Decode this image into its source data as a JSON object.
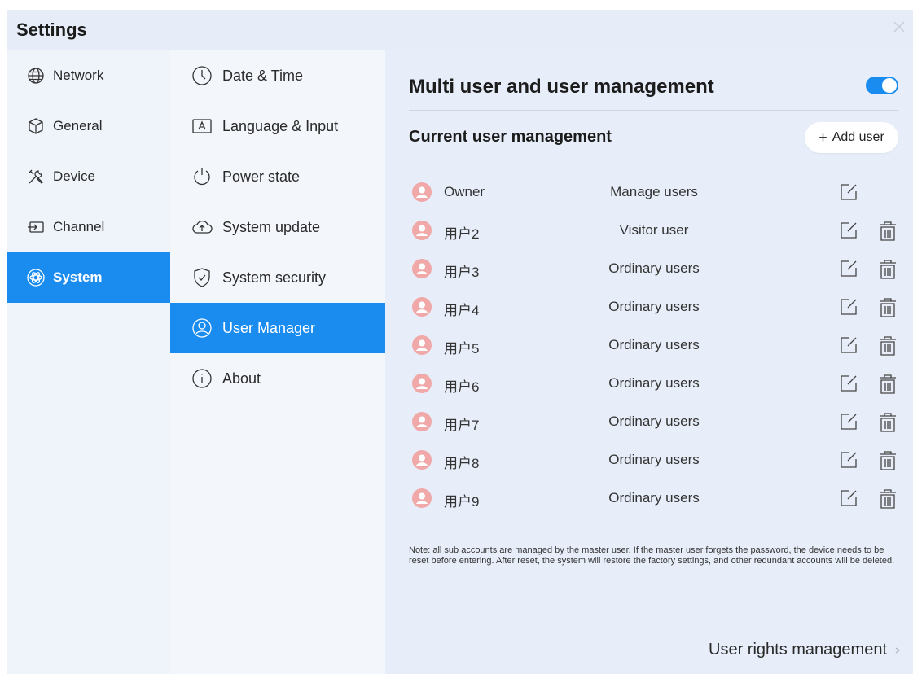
{
  "window": {
    "title": "Settings"
  },
  "nav1": {
    "items": [
      {
        "label": "Network",
        "icon": "globe-icon"
      },
      {
        "label": "General",
        "icon": "cube-icon"
      },
      {
        "label": "Device",
        "icon": "tools-icon"
      },
      {
        "label": "Channel",
        "icon": "input-icon"
      },
      {
        "label": "System",
        "icon": "atom-icon",
        "active": true
      }
    ]
  },
  "nav2": {
    "items": [
      {
        "label": "Date & Time",
        "icon": "clock-icon"
      },
      {
        "label": "Language & Input",
        "icon": "keyboard-a-icon"
      },
      {
        "label": "Power state",
        "icon": "power-icon"
      },
      {
        "label": "System update",
        "icon": "cloud-upload-icon"
      },
      {
        "label": "System security",
        "icon": "shield-icon"
      },
      {
        "label": "User Manager",
        "icon": "user-icon",
        "active": true
      },
      {
        "label": "About",
        "icon": "info-icon"
      }
    ]
  },
  "main": {
    "section_title": "Multi user and user management",
    "toggle_on": true,
    "subtitle": "Current user management",
    "add_user_label": "Add user",
    "users": [
      {
        "name": "Owner",
        "role": "Manage users",
        "deletable": false
      },
      {
        "name": "用户2",
        "role": "Visitor user",
        "deletable": true
      },
      {
        "name": "用户3",
        "role": "Ordinary users",
        "deletable": true
      },
      {
        "name": "用户4",
        "role": "Ordinary users",
        "deletable": true
      },
      {
        "name": "用户5",
        "role": "Ordinary users",
        "deletable": true
      },
      {
        "name": "用户6",
        "role": "Ordinary users",
        "deletable": true
      },
      {
        "name": "用户7",
        "role": "Ordinary users",
        "deletable": true
      },
      {
        "name": "用户8",
        "role": "Ordinary users",
        "deletable": true
      },
      {
        "name": "用户9",
        "role": "Ordinary users",
        "deletable": true
      }
    ],
    "note": "Note: all sub accounts are managed by the master user. If the master user forgets the password, the device needs to be reset before entering. After reset, the system will restore the factory settings, and other redundant accounts will be deleted.",
    "rights_label": "User rights management"
  },
  "colors": {
    "accent": "#1a8cf0",
    "avatar": "#f0a8a8"
  }
}
